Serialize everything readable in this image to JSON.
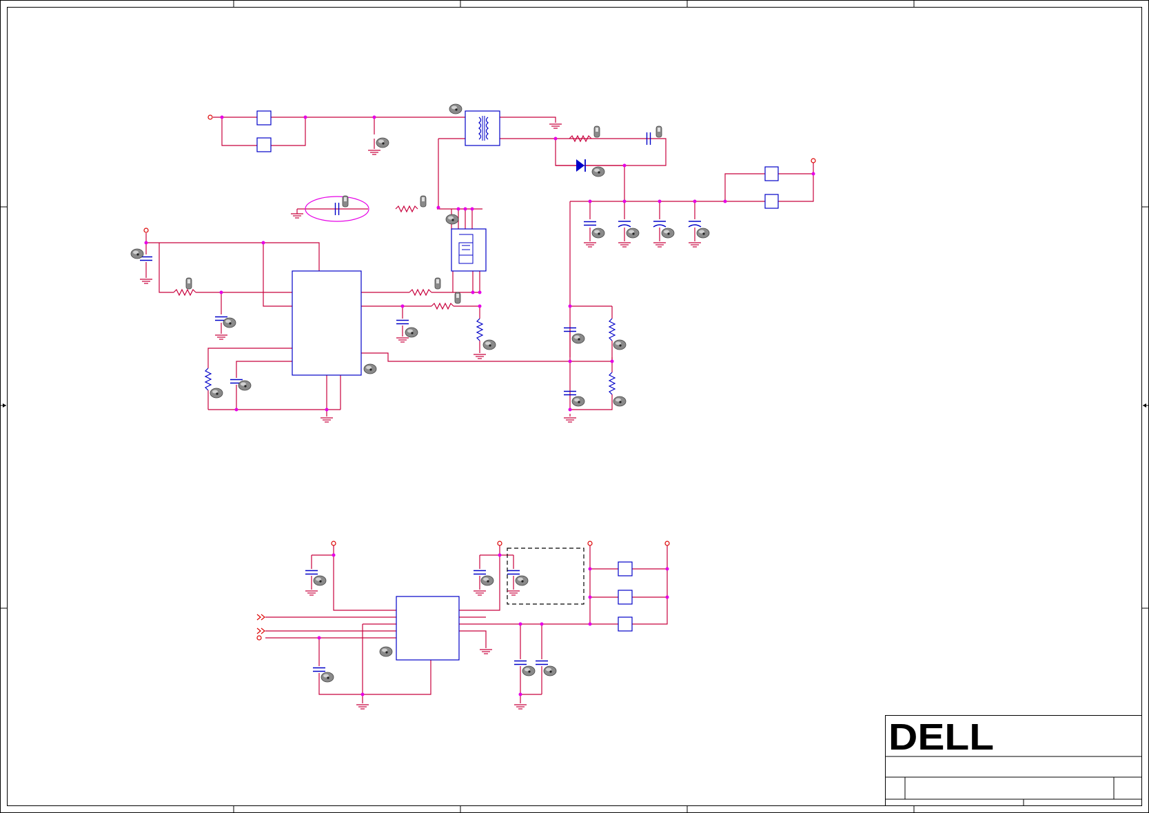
{
  "title_block": {
    "logo_text": "DELL",
    "title": "",
    "doc_number": "",
    "rev": "",
    "sheet": ""
  },
  "colors": {
    "wire": "#c8003c",
    "component": "#0000c8",
    "junction": "#e600e6",
    "power_port": "#dc0000",
    "frame": "#000000",
    "tag": "#6b6b6b"
  },
  "border": {
    "zone_labels_top": [],
    "zone_labels_side": []
  }
}
